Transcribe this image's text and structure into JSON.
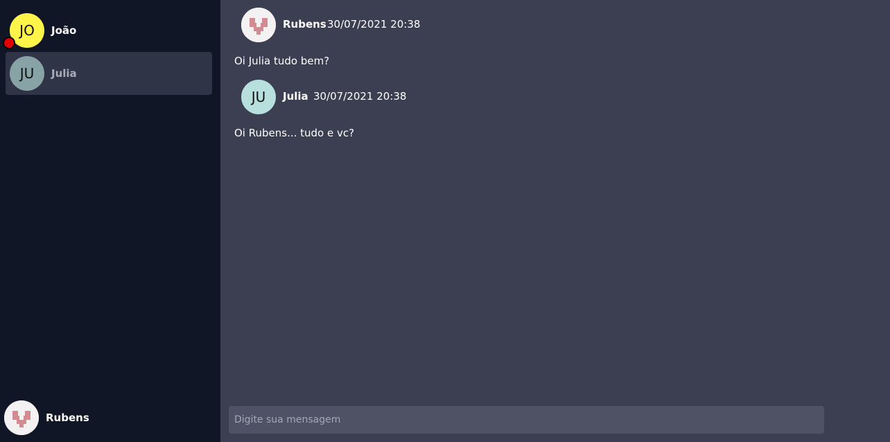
{
  "contacts": [
    {
      "initials": "JO",
      "name": "João",
      "avatar_color": "#fef44a",
      "unread": true,
      "active": false
    },
    {
      "initials": "JU",
      "name": "Julia",
      "avatar_color": "#87a3a5",
      "active": true
    }
  ],
  "current_user": {
    "name": "Rubens"
  },
  "messages": [
    {
      "author": "Rubens",
      "timestamp": "30/07/2021 20:38",
      "text": "Oi Julia tudo bem?",
      "avatar": "pixel-heart-icon"
    },
    {
      "author": "Julia",
      "initials": "JU",
      "avatar_color": "#b7dfde",
      "timestamp": "30/07/2021 20:38",
      "text": "Oi Rubens... tudo e vc?"
    }
  ],
  "composer": {
    "placeholder": "Digite sua mensagem"
  },
  "colors": {
    "sidebar_bg": "#111627",
    "main_bg": "#3b3f51",
    "active_contact_bg": "#2f3447",
    "input_bg": "#4e5264",
    "unread_dot": "#e00000"
  }
}
